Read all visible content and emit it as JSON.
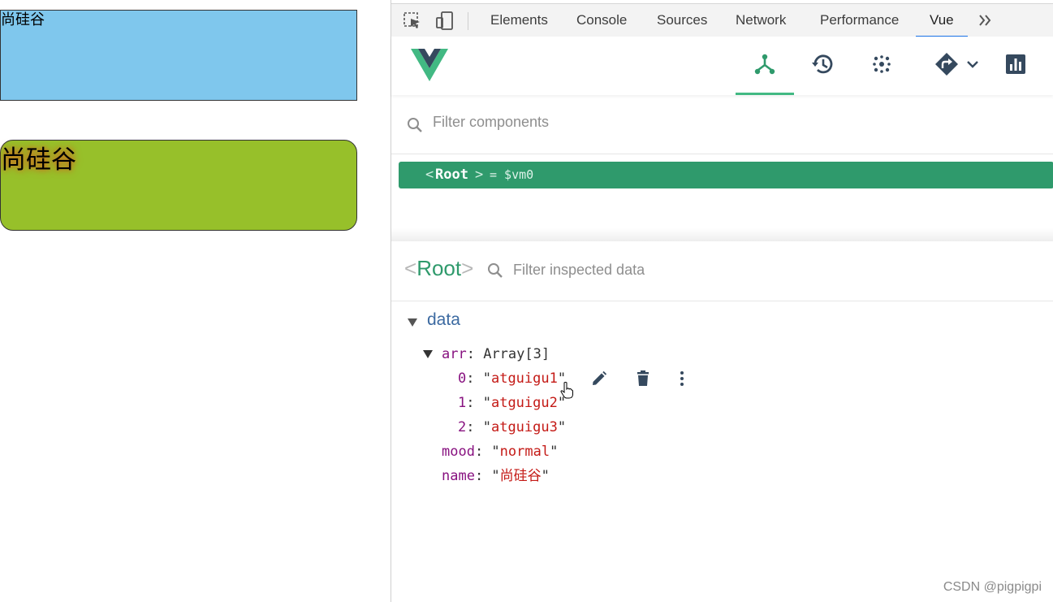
{
  "page": {
    "box1_text": "尚硅谷",
    "box2_text": "尚硅谷"
  },
  "devtools": {
    "tabs": [
      "Elements",
      "Console",
      "Sources",
      "Network",
      "Performance",
      "Vue"
    ],
    "active_tab": "Vue",
    "more_tabs_icon": "chevron-double-right-icon"
  },
  "vue": {
    "nav_icons": [
      "components-icon",
      "history-icon",
      "timeline-icon",
      "router-icon",
      "performance-chart-icon"
    ],
    "components_filter_placeholder": "Filter components",
    "tree": {
      "open": "<",
      "name": "Root",
      "close": ">",
      "suffix": "= $vm0"
    },
    "inspector": {
      "open": "<",
      "name": "Root",
      "close": ">",
      "filter_placeholder": "Filter inspected data",
      "section": "data",
      "arr_key": "arr",
      "arr_type": "Array[3]",
      "arr_items": [
        {
          "index": "0",
          "value": "atguigu1"
        },
        {
          "index": "1",
          "value": "atguigu2"
        },
        {
          "index": "2",
          "value": "atguigu3"
        }
      ],
      "mood_key": "mood",
      "mood_value": "normal",
      "name_key": "name",
      "name_value": "尚硅谷"
    },
    "accent": "#42b983",
    "selected_row_color": "#2f9a6c"
  },
  "watermark": "CSDN @pigpigpi"
}
